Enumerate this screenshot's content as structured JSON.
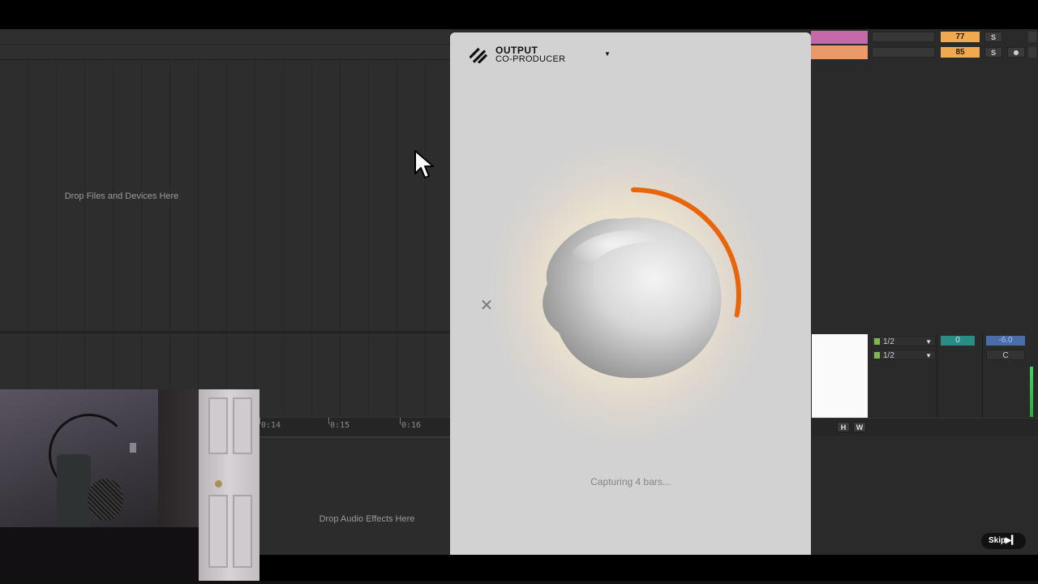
{
  "daw": {
    "drop_files_label": "Drop Files and Devices Here",
    "drop_effects_label": "Drop Audio Effects Here",
    "timeline_ticks": [
      "0:14",
      "0:15",
      "0:16"
    ]
  },
  "mixer": {
    "track1_tempo": "77",
    "track2_tempo": "85",
    "solo_label": "S",
    "input_rows": [
      "1/2",
      "1/2"
    ],
    "send_value": "0",
    "volume_value": "-6.0",
    "pan_value": "C",
    "h_label": "H",
    "w_label": "W",
    "colors": {
      "clip1": "#c46aa8",
      "clip2": "#e99a68",
      "tempo": "#efaa4e"
    }
  },
  "plugin": {
    "brand_line1": "OUTPUT",
    "brand_line2": "CO-PRODUCER",
    "caret_icon": "caret-down-icon",
    "close_icon": "close-icon",
    "status_text": "Capturing 4 bars...",
    "capture_progress": 0.28,
    "accent_color": "#e8650a"
  },
  "video": {
    "skip_label": "Skip",
    "skip_icon": "skip-next-icon",
    "progress": 0.0
  }
}
